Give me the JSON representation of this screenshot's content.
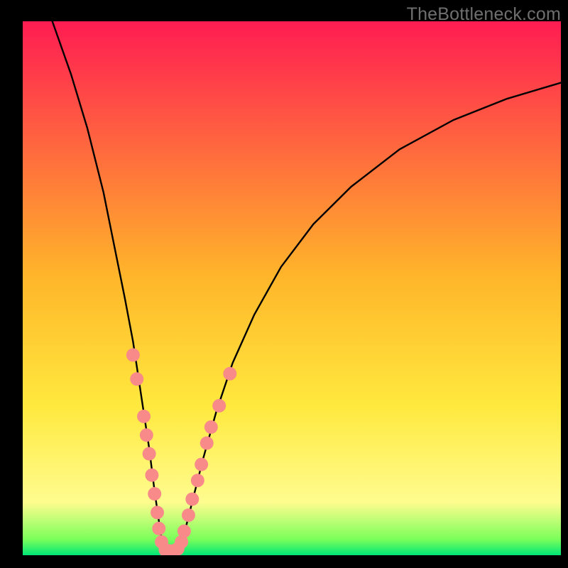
{
  "watermark": "TheBottleneck.com",
  "chart_data": {
    "type": "line",
    "title": "",
    "xlabel": "",
    "ylabel": "",
    "xlim": [
      0,
      100
    ],
    "ylim": [
      0,
      100
    ],
    "notes": "Bottleneck percentage curve. Vertical axis is bottleneck % (100 at top, 0 at bottom). Horizontal axis is a relative performance ratio (minimum/optimal point near x≈26). No numeric tick labels are shown on either axis.",
    "background_gradient": {
      "stops": [
        {
          "y_pct": 0,
          "color": "#ff1c52"
        },
        {
          "y_pct": 48,
          "color": "#ffb62a"
        },
        {
          "y_pct": 72,
          "color": "#ffe93e"
        },
        {
          "y_pct": 90,
          "color": "#fffc8f"
        },
        {
          "y_pct": 97,
          "color": "#7bff5a"
        },
        {
          "y_pct": 100,
          "color": "#00e676"
        }
      ]
    },
    "curve": {
      "description": "V-shaped curve: steep descent from top-left to bottom, then asymptotic rise toward upper-right.",
      "points_xy_pct": [
        [
          5.5,
          100
        ],
        [
          9,
          90
        ],
        [
          12,
          80
        ],
        [
          15,
          68
        ],
        [
          17,
          58
        ],
        [
          19,
          48
        ],
        [
          20.5,
          40
        ],
        [
          22,
          30
        ],
        [
          23.5,
          20
        ],
        [
          24.5,
          12
        ],
        [
          25.5,
          5
        ],
        [
          26,
          1.5
        ],
        [
          27,
          0.8
        ],
        [
          28,
          0.8
        ],
        [
          29,
          1.5
        ],
        [
          30,
          4
        ],
        [
          31.5,
          10
        ],
        [
          33.5,
          18
        ],
        [
          36,
          27
        ],
        [
          39,
          36
        ],
        [
          43,
          45
        ],
        [
          48,
          54
        ],
        [
          54,
          62
        ],
        [
          61,
          69
        ],
        [
          70,
          76
        ],
        [
          80,
          81.5
        ],
        [
          90,
          85.5
        ],
        [
          100,
          88.5
        ]
      ]
    },
    "markers": {
      "color": "#f98a8a",
      "radius_pct": 1.25,
      "description": "Salmon dot markers clustered in the lower legs of the V (approx. 0–28% y-range).",
      "points_xy_pct": [
        [
          20.5,
          37.5
        ],
        [
          21.2,
          33
        ],
        [
          22.5,
          26
        ],
        [
          23,
          22.5
        ],
        [
          23.5,
          19
        ],
        [
          24,
          15
        ],
        [
          24.5,
          11.5
        ],
        [
          25,
          8
        ],
        [
          25.3,
          5
        ],
        [
          25.8,
          2.5
        ],
        [
          26.5,
          1
        ],
        [
          27.2,
          0.8
        ],
        [
          28,
          0.8
        ],
        [
          28.8,
          1.2
        ],
        [
          29.5,
          2.5
        ],
        [
          30,
          4.5
        ],
        [
          30.8,
          7.5
        ],
        [
          31.5,
          10.5
        ],
        [
          32.5,
          14
        ],
        [
          33.2,
          17
        ],
        [
          34.2,
          21
        ],
        [
          35,
          24
        ],
        [
          36.5,
          28
        ],
        [
          38.5,
          34
        ]
      ]
    }
  }
}
